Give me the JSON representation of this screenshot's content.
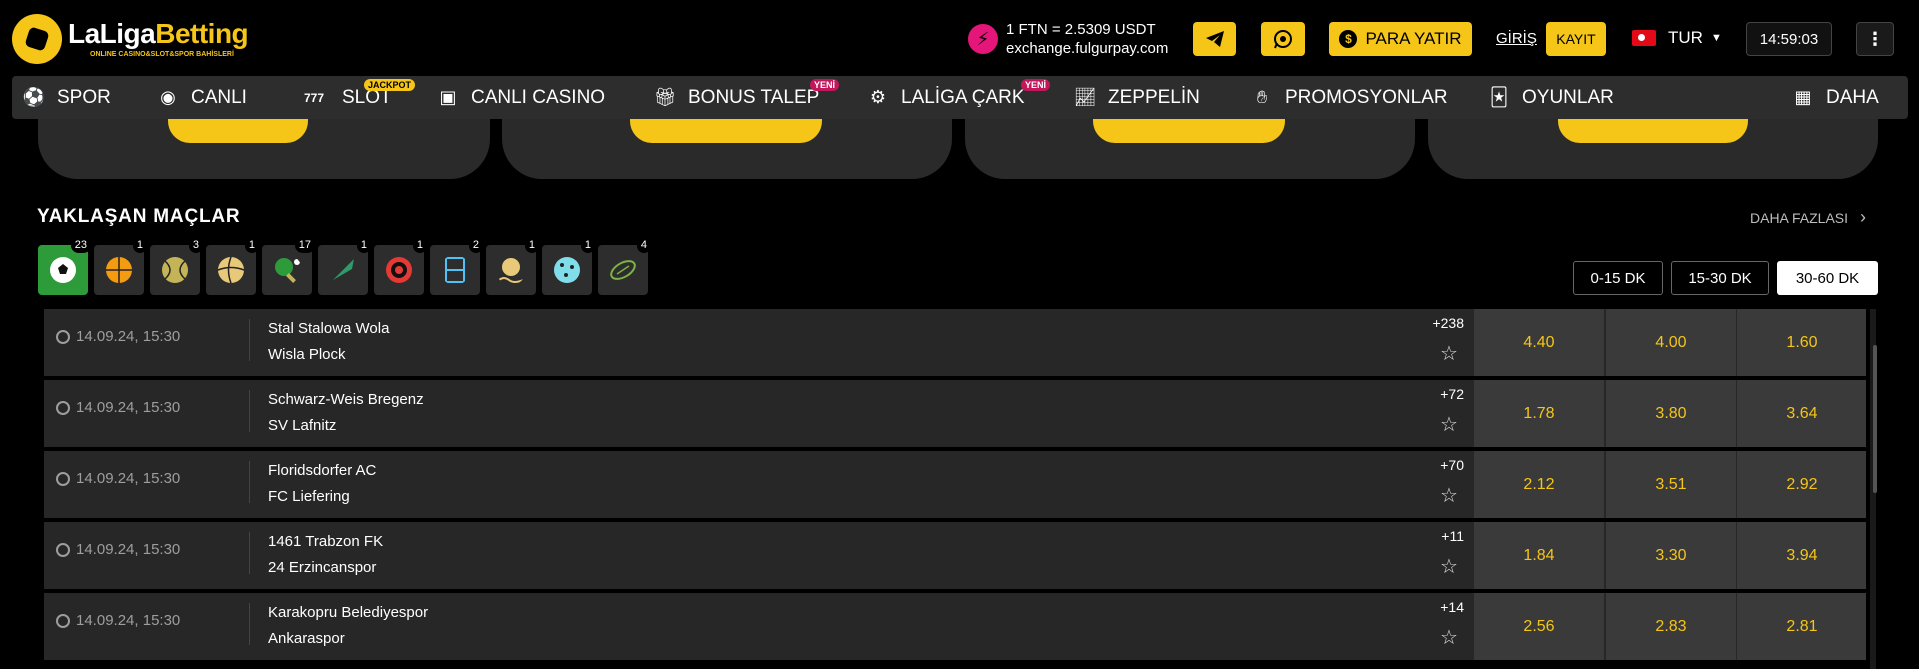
{
  "header": {
    "logo": {
      "brand_part1": "LaLiga",
      "brand_part2": "Betting",
      "tagline": "ONLINE CASINO&SLOT&SPOR BAHİSLERİ"
    },
    "exchange": {
      "rate": "1 FTN = 2.5309 USDT",
      "site": "exchange.fulgurpay.com"
    },
    "deposit_label": "PARA YATIR",
    "login_label": "GİRİŞ",
    "register_label": "KAYIT",
    "language": "TUR",
    "clock": "14:59:03"
  },
  "nav": {
    "items": [
      {
        "label": "SPOR",
        "icon": "sports-icon"
      },
      {
        "label": "CANLI",
        "icon": "live-icon"
      },
      {
        "label": "SLOT",
        "icon": "slot-777-icon",
        "badge": "JACKPOT"
      },
      {
        "label": "CANLI CASINO",
        "icon": "live-casino-icon"
      },
      {
        "label": "BONUS TALEP",
        "icon": "gift-icon",
        "badge": "YENİ"
      },
      {
        "label": "LALİGA ÇARK",
        "icon": "wheel-icon",
        "badge": "YENİ"
      },
      {
        "label": "ZEPPELİN",
        "icon": "chart-up-icon"
      },
      {
        "label": "PROMOSYONLAR",
        "icon": "promotions-icon"
      },
      {
        "label": "OYUNLAR",
        "icon": "games-icon"
      },
      {
        "label": "DAHA",
        "icon": "grid-icon"
      }
    ]
  },
  "upcoming": {
    "title": "YAKLAŞAN MAÇLAR",
    "more_label": "DAHA FAZLASI",
    "sports": [
      {
        "name": "football",
        "count": "23",
        "color": "#ffffff"
      },
      {
        "name": "basketball",
        "count": "1",
        "color": "#f39c12"
      },
      {
        "name": "tennis",
        "count": "3",
        "color": "#c5b358"
      },
      {
        "name": "volleyball",
        "count": "1",
        "color": "#e8c97a"
      },
      {
        "name": "table-tennis",
        "count": "17",
        "color": "#2e9b3a"
      },
      {
        "name": "badminton",
        "count": "1",
        "color": "#2e9b6a"
      },
      {
        "name": "darts",
        "count": "1",
        "color": "#e53935"
      },
      {
        "name": "futsal",
        "count": "2",
        "color": "#4fc3f7"
      },
      {
        "name": "beach-volleyball",
        "count": "1",
        "color": "#e8c97a"
      },
      {
        "name": "handball",
        "count": "1",
        "color": "#80deea"
      },
      {
        "name": "rugby",
        "count": "4",
        "color": "#7cb342"
      }
    ],
    "time_filters": [
      "0-15 DK",
      "15-30 DK",
      "30-60 DK"
    ],
    "active_filter": "30-60 DK",
    "matches": [
      {
        "time": "14.09.24, 15:30",
        "home": "Stal Stalowa Wola",
        "away": "Wisla Plock",
        "more": "+238",
        "odds": [
          "4.40",
          "4.00",
          "1.60"
        ]
      },
      {
        "time": "14.09.24, 15:30",
        "home": "Schwarz-Weis Bregenz",
        "away": "SV Lafnitz",
        "more": "+72",
        "odds": [
          "1.78",
          "3.80",
          "3.64"
        ]
      },
      {
        "time": "14.09.24, 15:30",
        "home": "Floridsdorfer AC",
        "away": "FC Liefering",
        "more": "+70",
        "odds": [
          "2.12",
          "3.51",
          "2.92"
        ]
      },
      {
        "time": "14.09.24, 15:30",
        "home": "1461 Trabzon FK",
        "away": "24 Erzincanspor",
        "more": "+11",
        "odds": [
          "1.84",
          "3.30",
          "3.94"
        ]
      },
      {
        "time": "14.09.24, 15:30",
        "home": "Karakopru Belediyespor",
        "away": "Ankaraspor",
        "more": "+14",
        "odds": [
          "2.56",
          "2.83",
          "2.81"
        ]
      }
    ]
  },
  "colors": {
    "accent": "#f5c518",
    "odds": "#f5c518",
    "active_sport": "#2e9b3a",
    "badge_new": "#c2185b"
  }
}
